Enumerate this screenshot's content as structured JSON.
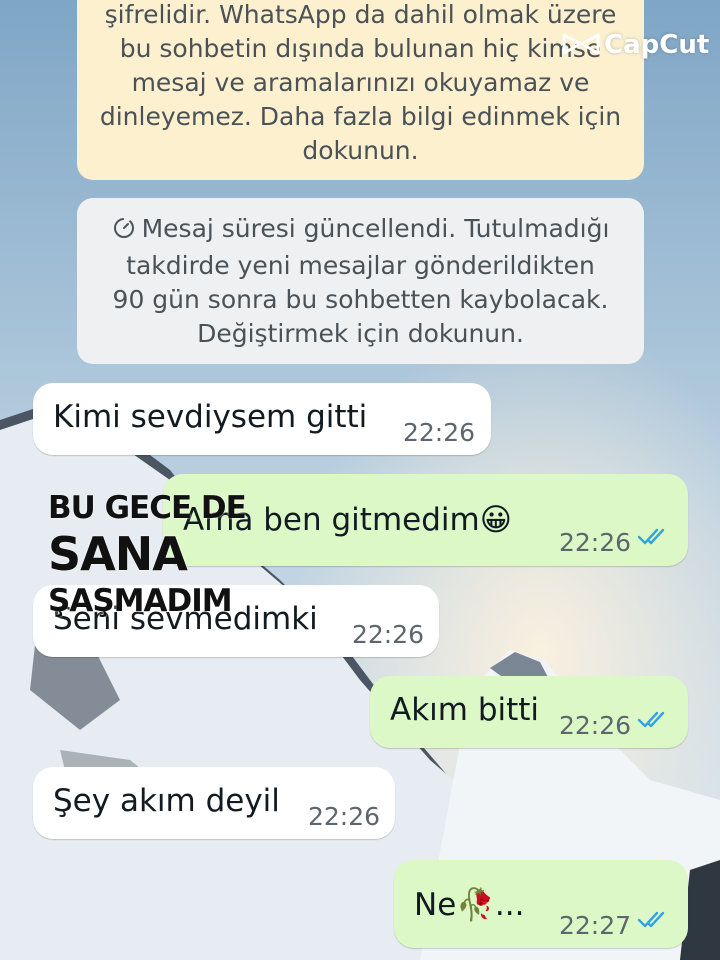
{
  "system_messages": {
    "encryption": {
      "lines": [
        "şifrelidir. WhatsApp da dahil olmak üzere",
        "bu sohbetin dışında bulunan hiç kimse",
        "mesaj ve aramalarınızı okuyamaz ve",
        "dinleyemez. Daha fazla bilgi edinmek için",
        "dokunun."
      ]
    },
    "disappearing": {
      "icon": "timer-icon",
      "lines": [
        "Mesaj süresi güncellendi. Tutulmadığı",
        "takdirde yeni mesajlar gönderildikten",
        "90 gün sonra bu sohbetten kaybolacak.",
        "Değiştirmek için dokunun."
      ]
    }
  },
  "messages": [
    {
      "direction": "incoming",
      "text": "Kimi sevdiysem gitti",
      "time": "22:26"
    },
    {
      "direction": "outgoing",
      "text": "Ama ben gitmedim😀",
      "time": "22:26",
      "status": "read"
    },
    {
      "direction": "incoming",
      "text": "Seni sevmedimki",
      "time": "22:26"
    },
    {
      "direction": "outgoing",
      "text": "Akım bitti",
      "time": "22:26",
      "status": "read"
    },
    {
      "direction": "incoming",
      "text": "Şey akım deyil",
      "time": "22:26"
    },
    {
      "direction": "outgoing",
      "text": "Ne🥀...",
      "time": "22:27",
      "status": "read"
    }
  ],
  "overlay": {
    "line1": "BU GECE DE",
    "line2": "SANA",
    "line3": "ŞAŞMADIM"
  },
  "watermark": {
    "label": "CapCut",
    "icon": "capcut-logo-icon"
  },
  "colors": {
    "incoming_bubble": "#ffffff",
    "outgoing_bubble": "#dcf8c6",
    "encryption_notice": "#fcf0cf",
    "read_ticks": "#34a3e0"
  }
}
